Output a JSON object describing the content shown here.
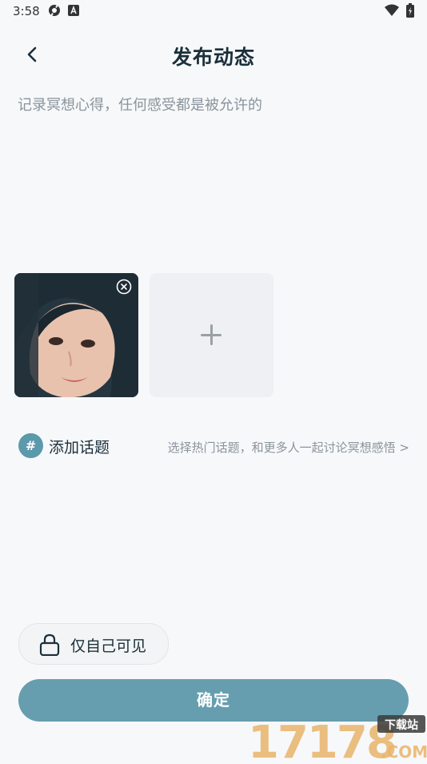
{
  "status_bar": {
    "time": "3:58",
    "icons": [
      "settings-app-icon",
      "a-app-icon",
      "wifi-icon",
      "battery-icon"
    ]
  },
  "header": {
    "title": "发布动态",
    "back_icon": "chevron-left-icon"
  },
  "composer": {
    "placeholder": "记录冥想心得，任何感受都是被允许的",
    "value": ""
  },
  "photos": {
    "items": [
      {
        "alt": "photo",
        "remove_icon": "close-circle-icon"
      }
    ],
    "add_icon": "plus-icon"
  },
  "topic": {
    "hash_symbol": "#",
    "label": "添加话题",
    "hint": "选择热门话题，和更多人一起讨论冥想感悟 >"
  },
  "visibility": {
    "icon": "lock-icon",
    "label": "仅自己可见"
  },
  "confirm": {
    "label": "确定"
  },
  "watermark": {
    "text_numbers": "17178",
    "text_com": ".COM",
    "text_badge": "下载站"
  },
  "colors": {
    "accent": "#669eaf",
    "hash_badge": "#5b99ab",
    "background": "#f7f8fa",
    "title": "#1a2f3b",
    "hint": "#8a949c"
  }
}
